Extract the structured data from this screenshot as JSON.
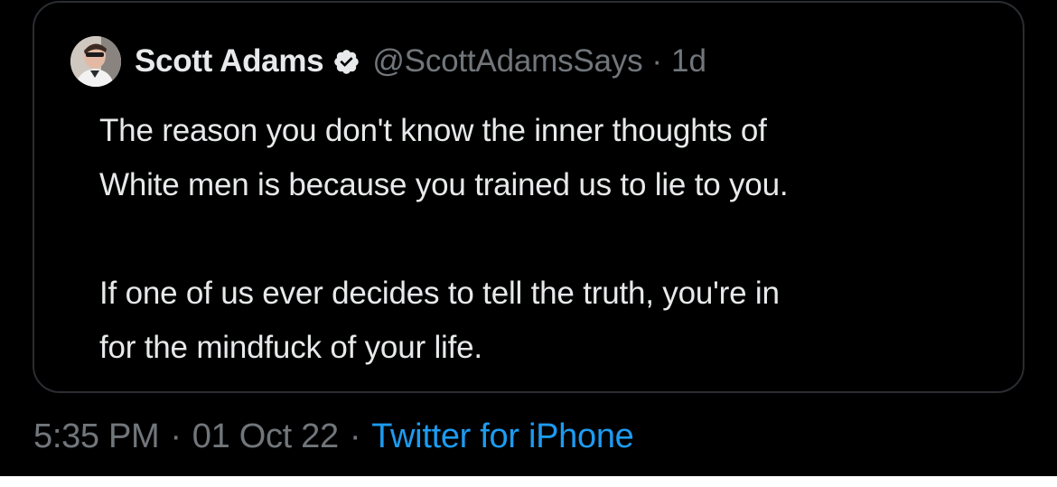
{
  "quoted_tweet": {
    "author": {
      "display_name": "Scott Adams",
      "handle": "@ScottAdamsSays",
      "verified": true,
      "verified_icon": "verified-badge-icon",
      "avatar_icon": "profile-avatar"
    },
    "separator": "·",
    "time_ago": "1d",
    "text_lines": [
      "The reason you don't know the inner thoughts of",
      "White men is because you trained us to lie to you.",
      "If one of us ever decides to tell the truth, you're in",
      "for the mindfuck of your life."
    ]
  },
  "tweet_meta": {
    "time": "5:35 PM",
    "date": "01 Oct 22",
    "separator": "·",
    "source": "Twitter for iPhone"
  },
  "colors": {
    "background": "#000000",
    "primary_text": "#e7e9ea",
    "secondary_text": "#71767b",
    "link": "#1d9bf0",
    "card_border": "#2a2d31"
  }
}
